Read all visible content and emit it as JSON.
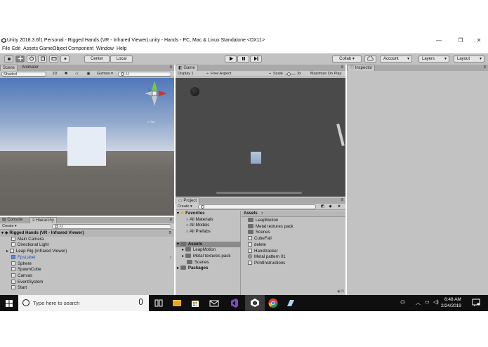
{
  "window": {
    "title": "Unity 2018.3.6f1 Personal - Rigged Hands (VR - Infrared Viewer).unity - Hands - PC, Mac & Linux Standalone <DX11>",
    "minimize": "—",
    "maximize": "❐",
    "close": "✕"
  },
  "menu": [
    "File",
    "Edit",
    "Assets",
    "GameObject",
    "Component",
    "Window",
    "Help"
  ],
  "toolbar": {
    "pivot": "Center",
    "space": "Local",
    "collab": "Collab ▾",
    "account": "Account",
    "layers": "Layers",
    "layout": "Layout",
    "dropdown_arrow": "▾"
  },
  "scene": {
    "tab_scene": "Scene",
    "tab_animator": "Animator",
    "shading": "Shaded",
    "mode_2d": "2D",
    "gizmos": "Gizmos ▾",
    "search_placeholder": "All",
    "iso": "Iso",
    "axis_x": "x",
    "axis_y": "y",
    "axis_z": "z"
  },
  "game": {
    "tab": "Game",
    "display": "Display 1",
    "aspect": "Free Aspect",
    "scale_label": "Scale",
    "scale_value": "3x",
    "maximize": "Maximize On Play"
  },
  "inspector": {
    "tab": "Inspector"
  },
  "console": {
    "tab_console": "Console",
    "tab_hierarchy": "Hierarchy",
    "create": "Create ▾",
    "search_placeholder": "All",
    "scene_name": "Rigged Hands (VR - Infrared Viewer)",
    "items": [
      "Main Camera",
      "Directional Light",
      "Leap Rig (Infrared Viewer)",
      "FpsLabel",
      "Sphere",
      "SpawnCube",
      "Canvas",
      "EventSystem",
      "Start"
    ]
  },
  "project": {
    "tab": "Project",
    "create": "Create ▾",
    "favorites_label": "Favorites",
    "favorites": [
      "All Materials",
      "All Models",
      "All Prefabs"
    ],
    "assets_label": "Assets",
    "tree_assets": [
      "LeapMotion",
      "Metal textures pack",
      "Scenes"
    ],
    "packages_label": "Packages",
    "breadcrumb": "Assets",
    "breadcrumb_arrow": "›",
    "files": [
      "LeapMotion",
      "Metal textures pack",
      "Scenes",
      "CubeFall",
      "delete",
      "Handtracker",
      "Metal pattern 01",
      "PrintInstructions"
    ],
    "count_badge": "15"
  },
  "taskbar": {
    "search_placeholder": "Type here to search",
    "time": "6:48 AM",
    "date": "2/24/2019"
  },
  "colors": {
    "sky_top": "#4f77b9",
    "sky_horizon": "#d5dbe4",
    "ground": "#6e6a65",
    "game_bg": "#4a4a4a",
    "panel": "#c2c2c2",
    "selection": "#8a8a8a",
    "taskbar": "#0f0f0f"
  }
}
